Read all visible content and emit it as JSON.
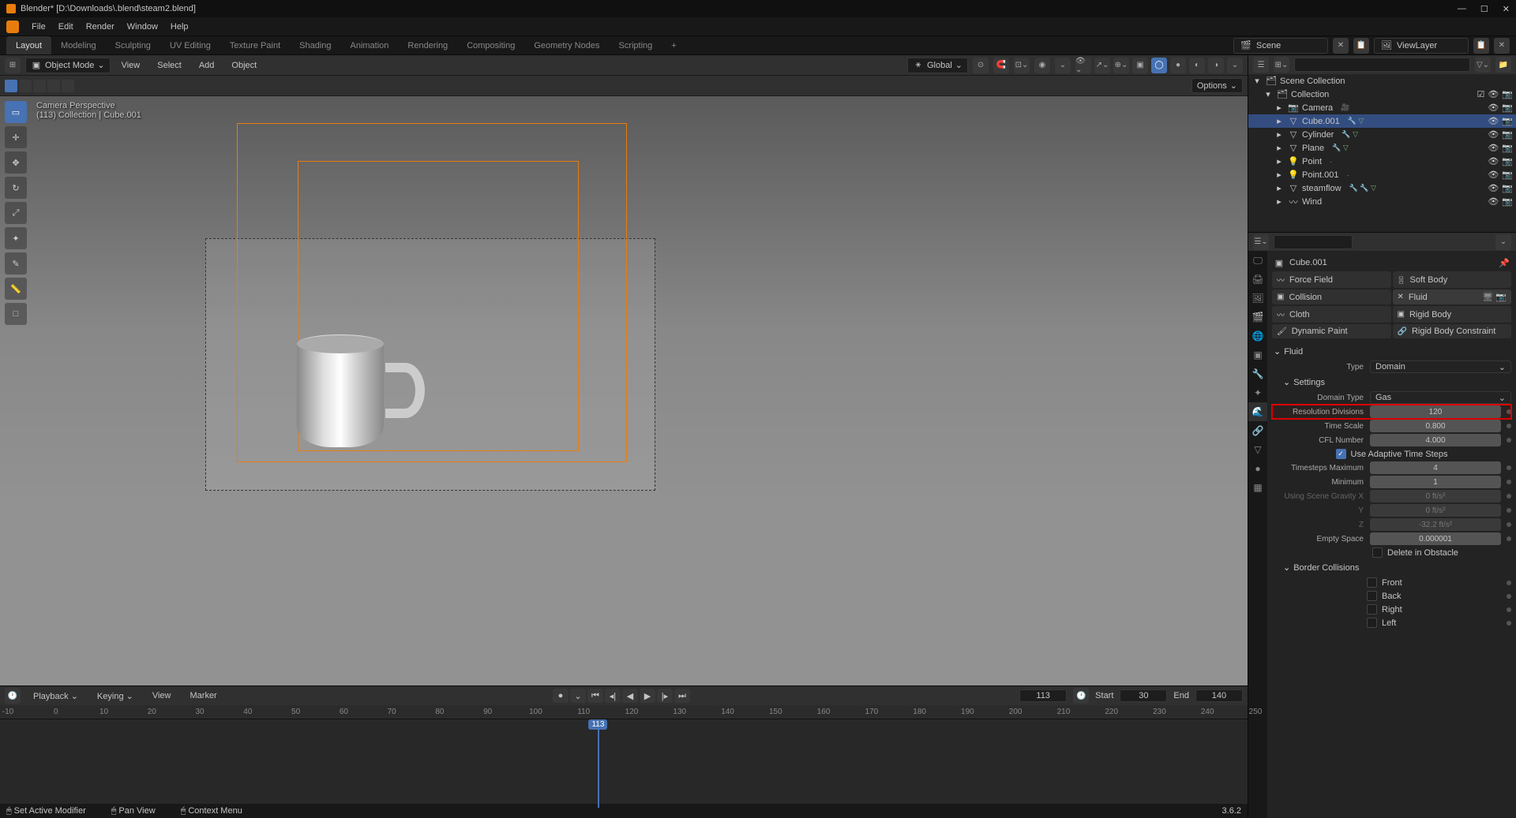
{
  "title": "Blender* [D:\\Downloads\\.blend\\steam2.blend]",
  "topmenu": [
    "File",
    "Edit",
    "Render",
    "Window",
    "Help"
  ],
  "workspaces": [
    "Layout",
    "Modeling",
    "Sculpting",
    "UV Editing",
    "Texture Paint",
    "Shading",
    "Animation",
    "Rendering",
    "Compositing",
    "Geometry Nodes",
    "Scripting"
  ],
  "scene_label": "Scene",
  "viewlayer_label": "ViewLayer",
  "viewport_header": {
    "mode": "Object Mode",
    "menus": [
      "View",
      "Select",
      "Add",
      "Object"
    ],
    "orient": "Global",
    "options_label": "Options"
  },
  "overlay": {
    "line1": "Camera Perspective",
    "line2": "(113) Collection | Cube.001"
  },
  "outliner": {
    "root": "Scene Collection",
    "collection": "Collection",
    "items": [
      {
        "name": "Camera",
        "icon": "📷",
        "extras": [
          "🎥"
        ]
      },
      {
        "name": "Cube.001",
        "icon": "▽",
        "extras": [
          "🔧",
          "▽"
        ],
        "selected": true
      },
      {
        "name": "Cylinder",
        "icon": "▽",
        "extras": [
          "🔧",
          "▽"
        ]
      },
      {
        "name": "Plane",
        "icon": "▽",
        "extras": [
          "🔧",
          "▽"
        ]
      },
      {
        "name": "Point",
        "icon": "💡",
        "extras": [
          "·"
        ]
      },
      {
        "name": "Point.001",
        "icon": "💡",
        "extras": [
          "·"
        ]
      },
      {
        "name": "steamflow",
        "icon": "▽",
        "extras": [
          "🔧",
          "🔧",
          "▽"
        ]
      },
      {
        "name": "Wind",
        "icon": "〰",
        "extras": []
      }
    ]
  },
  "breadcrumb": {
    "obj": "Cube.001"
  },
  "physics_buttons": {
    "force_field": "Force Field",
    "soft_body": "Soft Body",
    "collision": "Collision",
    "fluid": "Fluid",
    "cloth": "Cloth",
    "rigid_body": "Rigid Body",
    "dynamic_paint": "Dynamic Paint",
    "rigid_body_constraint": "Rigid Body Constraint"
  },
  "fluid_section": "Fluid",
  "fluid": {
    "type_label": "Type",
    "type_value": "Domain",
    "settings_label": "Settings",
    "domain_type_label": "Domain Type",
    "domain_type_value": "Gas",
    "res_label": "Resolution Divisions",
    "res_value": "120",
    "time_scale_label": "Time Scale",
    "time_scale_value": "0.800",
    "cfl_label": "CFL Number",
    "cfl_value": "4.000",
    "adaptive_label": "Use Adaptive Time Steps",
    "ts_max_label": "Timesteps Maximum",
    "ts_max_value": "4",
    "ts_min_label": "Minimum",
    "ts_min_value": "1",
    "gravity_label": "Using Scene Gravity X",
    "gx": "0 ft/s²",
    "gy_label": "Y",
    "gy": "0 ft/s²",
    "gz_label": "Z",
    "gz": "-32.2 ft/s²",
    "empty_space_label": "Empty Space",
    "empty_space_value": "0.000001",
    "delete_obstacle_label": "Delete in Obstacle",
    "border_label": "Border Collisions",
    "border_front": "Front",
    "border_back": "Back",
    "border_right": "Right",
    "border_left": "Left"
  },
  "timeline": {
    "menus": [
      "Playback",
      "Keying",
      "View",
      "Marker"
    ],
    "ticks": [
      -10,
      0,
      10,
      20,
      30,
      40,
      50,
      60,
      70,
      80,
      90,
      100,
      110,
      120,
      130,
      140,
      150,
      160,
      170,
      180,
      190,
      200,
      210,
      220,
      230,
      240,
      250
    ],
    "current": "113",
    "start_label": "Start",
    "start": "30",
    "end_label": "End",
    "end": "140"
  },
  "status": {
    "left": "Set Active Modifier",
    "mid": "Pan View",
    "right": "Context Menu",
    "version": "3.6.2"
  }
}
